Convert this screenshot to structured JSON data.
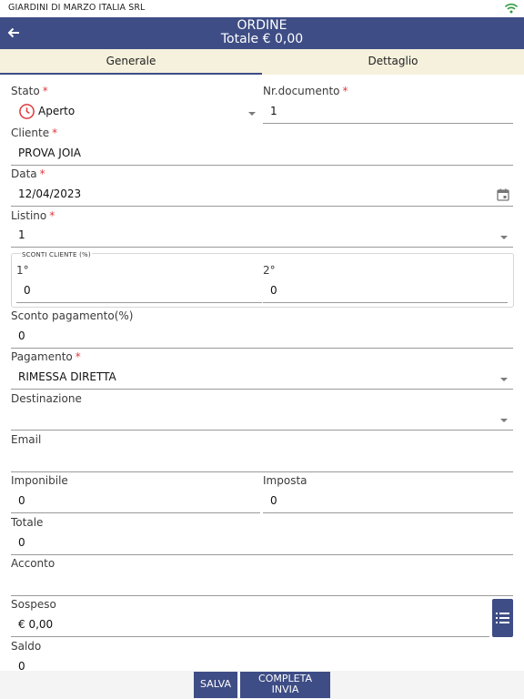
{
  "status_bar": {
    "company": "GIARDINI DI MARZO ITALIA SRL"
  },
  "header": {
    "title": "ORDINE",
    "subtitle": "Totale € 0,00"
  },
  "tabs": [
    {
      "label": "Generale"
    },
    {
      "label": "Dettaglio"
    }
  ],
  "form": {
    "stato": {
      "label": "Stato",
      "value": "Aperto"
    },
    "nr_documento": {
      "label": "Nr.documento",
      "value": "1"
    },
    "cliente": {
      "label": "Cliente",
      "value": "PROVA JOIA"
    },
    "data": {
      "label": "Data",
      "value": "12/04/2023"
    },
    "listino": {
      "label": "Listino",
      "value": "1"
    },
    "sconti_cliente": {
      "title": "SCONTI CLIENTE (%)",
      "first": {
        "label": "1°",
        "value": "0"
      },
      "second": {
        "label": "2°",
        "value": "0"
      }
    },
    "sconto_pagamento": {
      "label": "Sconto pagamento(%)",
      "value": "0"
    },
    "pagamento": {
      "label": "Pagamento",
      "value": "RIMESSA DIRETTA"
    },
    "destinazione": {
      "label": "Destinazione",
      "value": ""
    },
    "email": {
      "label": "Email",
      "value": ""
    },
    "imponibile": {
      "label": "Imponibile",
      "value": "0"
    },
    "imposta": {
      "label": "Imposta",
      "value": "0"
    },
    "totale": {
      "label": "Totale",
      "value": "0"
    },
    "acconto": {
      "label": "Acconto",
      "value": ""
    },
    "sospeso": {
      "label": "Sospeso",
      "value": "€ 0,00"
    },
    "saldo": {
      "label": "Saldo",
      "value": "0"
    }
  },
  "actions": {
    "salva": "SALVA",
    "completa_line1": "COMPLETA",
    "completa_line2": "INVIA"
  },
  "colors": {
    "primary": "#3e4d85",
    "tab_bg": "#f6f1dc",
    "required": "#e0393e",
    "status_icon": "#e0393e"
  },
  "icons": {
    "back": "arrow-left-icon",
    "wifi": "wifi-icon",
    "stato": "clock-icon",
    "data": "calendar-icon",
    "list": "list-icon"
  }
}
